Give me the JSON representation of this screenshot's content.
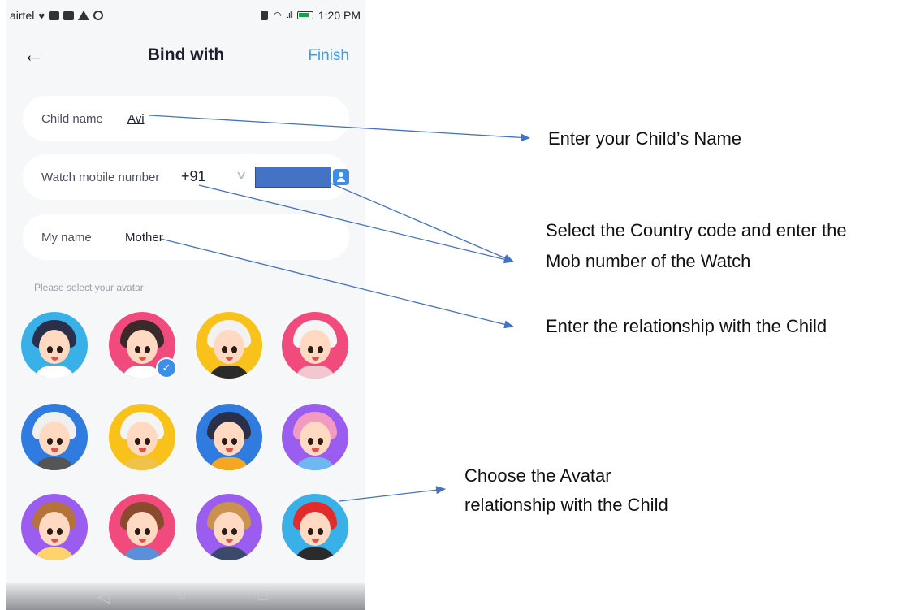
{
  "status_bar": {
    "carrier": "airtel",
    "time": "1:20 PM"
  },
  "header": {
    "back_icon": "arrow-left-icon",
    "title": "Bind with",
    "finish_label": "Finish"
  },
  "fields": {
    "child_name": {
      "label": "Child name",
      "value": "Avi"
    },
    "watch_number": {
      "label": "Watch mobile number",
      "country_code": "+91"
    },
    "my_name": {
      "label": "My name",
      "value": "Mother"
    }
  },
  "avatar_hint": "Please select your avatar",
  "avatars": [
    {
      "name": "avatar-dad",
      "bg": "#3ab0e8",
      "selected": false
    },
    {
      "name": "avatar-mom",
      "bg": "#f04b7c",
      "selected": true
    },
    {
      "name": "avatar-grandpa",
      "bg": "#f8c21a",
      "selected": false
    },
    {
      "name": "avatar-grandma",
      "bg": "#f04b7c",
      "selected": false
    },
    {
      "name": "avatar-grandpa-2",
      "bg": "#2f7be0",
      "selected": false
    },
    {
      "name": "avatar-grandma-2",
      "bg": "#f8c21a",
      "selected": false
    },
    {
      "name": "avatar-uncle",
      "bg": "#2f7be0",
      "selected": false
    },
    {
      "name": "avatar-aunt",
      "bg": "#9b5cf0",
      "selected": false
    },
    {
      "name": "avatar-brother",
      "bg": "#9b5cf0",
      "selected": false
    },
    {
      "name": "avatar-sister",
      "bg": "#f04b7c",
      "selected": false
    },
    {
      "name": "avatar-man-beard",
      "bg": "#9b5cf0",
      "selected": false
    },
    {
      "name": "avatar-boy",
      "bg": "#3ab0e8",
      "selected": false
    }
  ],
  "annotations": {
    "child_name": "Enter your Child’s Name",
    "country_code_line1": "Select the Country code and enter the",
    "country_code_line2": "Mob number of the Watch",
    "relationship": "Enter the relationship with the Child",
    "avatar_line1": "Choose the Avatar",
    "avatar_line2": "relationship with the Child"
  },
  "colors": {
    "accent": "#3aa1e8",
    "selected_check": "#3d8ee6",
    "annotation_line": "#4472c4",
    "masked_number": "#4472c4"
  }
}
